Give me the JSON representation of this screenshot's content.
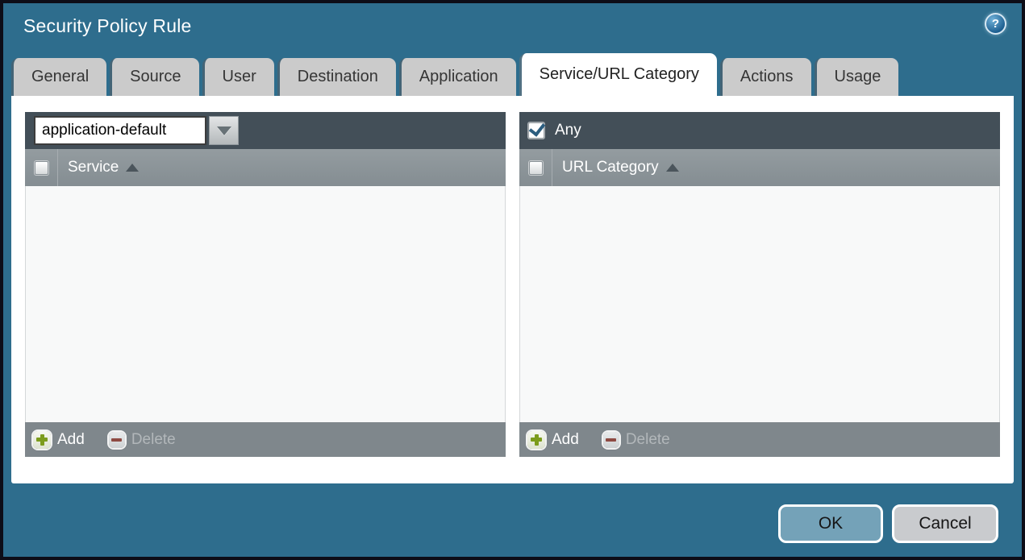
{
  "dialog": {
    "title": "Security Policy Rule"
  },
  "icons": {
    "help": "?",
    "dropdown_arrow": "triangle-down",
    "sort_ascending": "triangle-up",
    "add": "green-plus",
    "delete": "red-minus",
    "checkmark": "check"
  },
  "tabs": [
    {
      "label": "General",
      "active": false
    },
    {
      "label": "Source",
      "active": false
    },
    {
      "label": "User",
      "active": false
    },
    {
      "label": "Destination",
      "active": false
    },
    {
      "label": "Application",
      "active": false
    },
    {
      "label": "Service/URL Category",
      "active": true
    },
    {
      "label": "Actions",
      "active": false
    },
    {
      "label": "Usage",
      "active": false
    }
  ],
  "service_panel": {
    "dropdown": {
      "value": "application-default"
    },
    "column_header": {
      "label": "Service",
      "sort": "ascending",
      "checkbox_checked": false
    },
    "rows": [],
    "footer": {
      "add_label": "Add",
      "delete_label": "Delete",
      "add_enabled": true,
      "delete_enabled": false
    }
  },
  "url_category_panel": {
    "any_checkbox": {
      "label": "Any",
      "checked": true
    },
    "column_header": {
      "label": "URL Category",
      "sort": "ascending",
      "checkbox_checked": false
    },
    "rows": [],
    "footer": {
      "add_label": "Add",
      "delete_label": "Delete",
      "add_enabled": true,
      "delete_enabled": false
    }
  },
  "actions": {
    "ok_label": "OK",
    "cancel_label": "Cancel"
  },
  "colors": {
    "background_teal": "#2e6d8d",
    "outer_border": "#0d0d17",
    "panel_header_dark": "#434f58",
    "column_header_gray": "#8a9297",
    "footer_gray": "#7f878c",
    "tab_inactive": "#cbcbcb",
    "tab_active": "#ffffff",
    "add_icon_green": "#7c9c1c",
    "delete_icon_red": "#8e4a42",
    "ok_button_blue": "#74a2b8",
    "cancel_button_gray": "#c9cbce",
    "checkmark_blue": "#2b5d7f"
  }
}
